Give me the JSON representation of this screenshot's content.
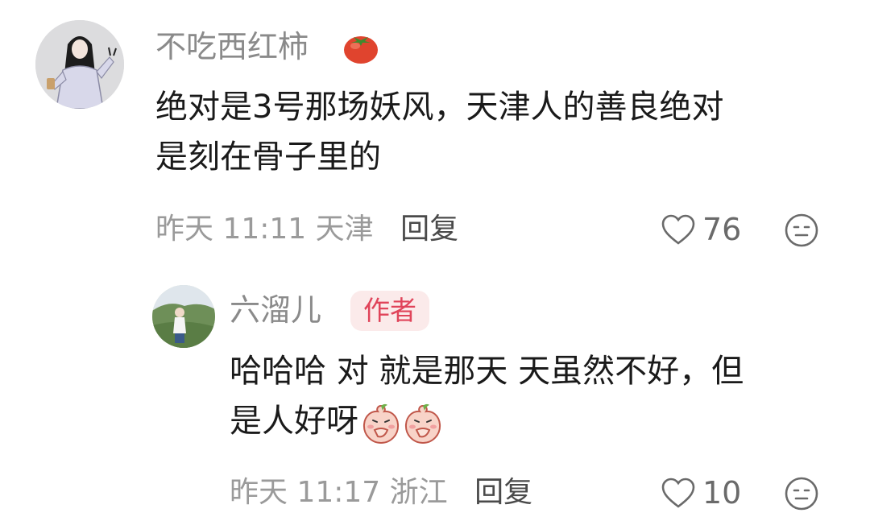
{
  "comments": [
    {
      "username": "不吃西红柿",
      "name_icon": "tomato-icon",
      "content_lines": [
        "绝对是3号那场妖风，天津人的善良绝对",
        "是刻在骨子里的"
      ],
      "time": "昨天 11:11",
      "location": "天津",
      "reply_label": "回复",
      "likes": "76",
      "dislike_icon": "dislike-face-icon"
    },
    {
      "username": "六溜儿",
      "badge": "作者",
      "content_lines": [
        "哈哈哈 对 就是那天 天虽然不好，但",
        "是人好呀"
      ],
      "content_emoji": [
        "peach-cover-mouth-emoji",
        "peach-cover-mouth-emoji"
      ],
      "time": "昨天 11:17",
      "location": "浙江",
      "reply_label": "回复",
      "likes": "10",
      "dislike_icon": "dislike-face-icon"
    }
  ],
  "colors": {
    "username": "#8a8a8a",
    "meta": "#9a9a9a",
    "reply": "#4a4a4a",
    "badge_text": "#e0445a",
    "badge_bg": "#fbeaea",
    "content": "#1a1a1a"
  }
}
